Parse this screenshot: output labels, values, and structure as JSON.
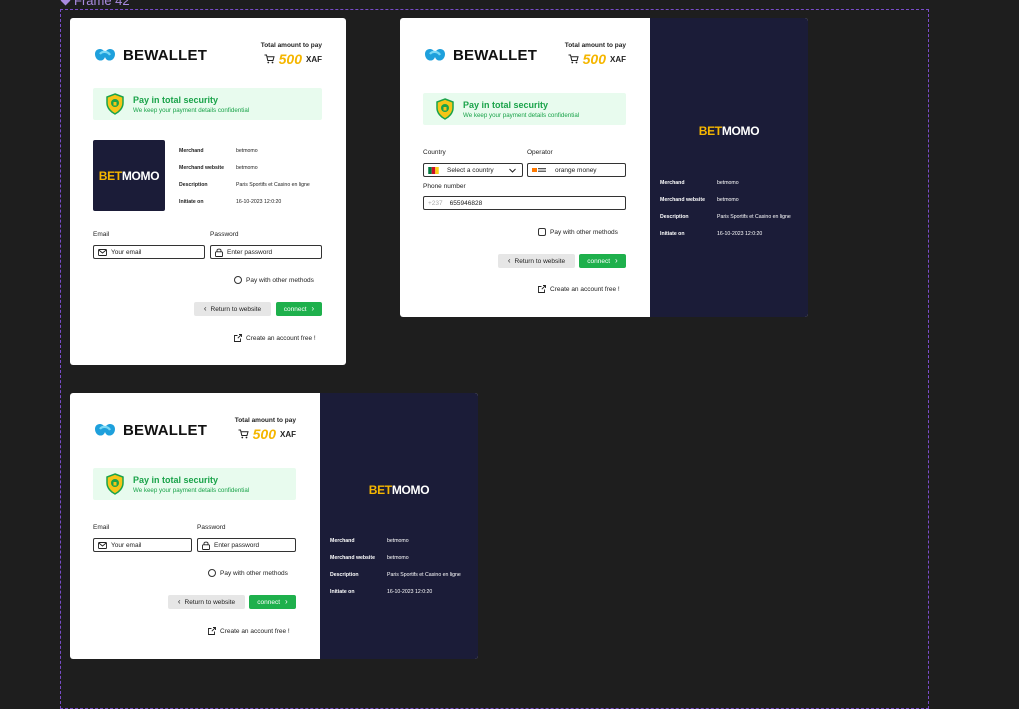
{
  "frame": {
    "label": "Frame 42"
  },
  "brand": {
    "name": "BEWALLET"
  },
  "total": {
    "label": "Total amount  to pay",
    "amount": "500",
    "currency": "XAF"
  },
  "security": {
    "title": "Pay in total security",
    "subtitle": "We keep your payment details confidential"
  },
  "merchant": {
    "logo_bet": "BET",
    "logo_momo": "MOMO",
    "rows": [
      {
        "key": "Merchand",
        "value": "betmomo"
      },
      {
        "key": "Merchand website",
        "value": "betmomo"
      },
      {
        "key": "Description",
        "value": "Paris Sportifs et Casino en ligne"
      },
      {
        "key": "Initiate on",
        "value": "16-10-2023 12:0:20"
      }
    ]
  },
  "login": {
    "email_label": "Email",
    "email_placeholder": "Your email",
    "password_label": "Password",
    "password_placeholder": "Enter password"
  },
  "mobile": {
    "country_label": "Country",
    "country_value": "Select a country",
    "operator_label": "Operator",
    "operator_value": "orange money",
    "phone_label": "Phone number",
    "phone_prefix": "+237",
    "phone_value": "655946828"
  },
  "actions": {
    "other_methods": "Pay with other methods",
    "return": "Return to website",
    "connect": "connect",
    "create_account": "Create an account free !"
  },
  "colors": {
    "accent": "#1eb04c",
    "amount": "#f5b600",
    "dark_panel": "#1b1c38",
    "security_bg": "#e8fbee"
  }
}
